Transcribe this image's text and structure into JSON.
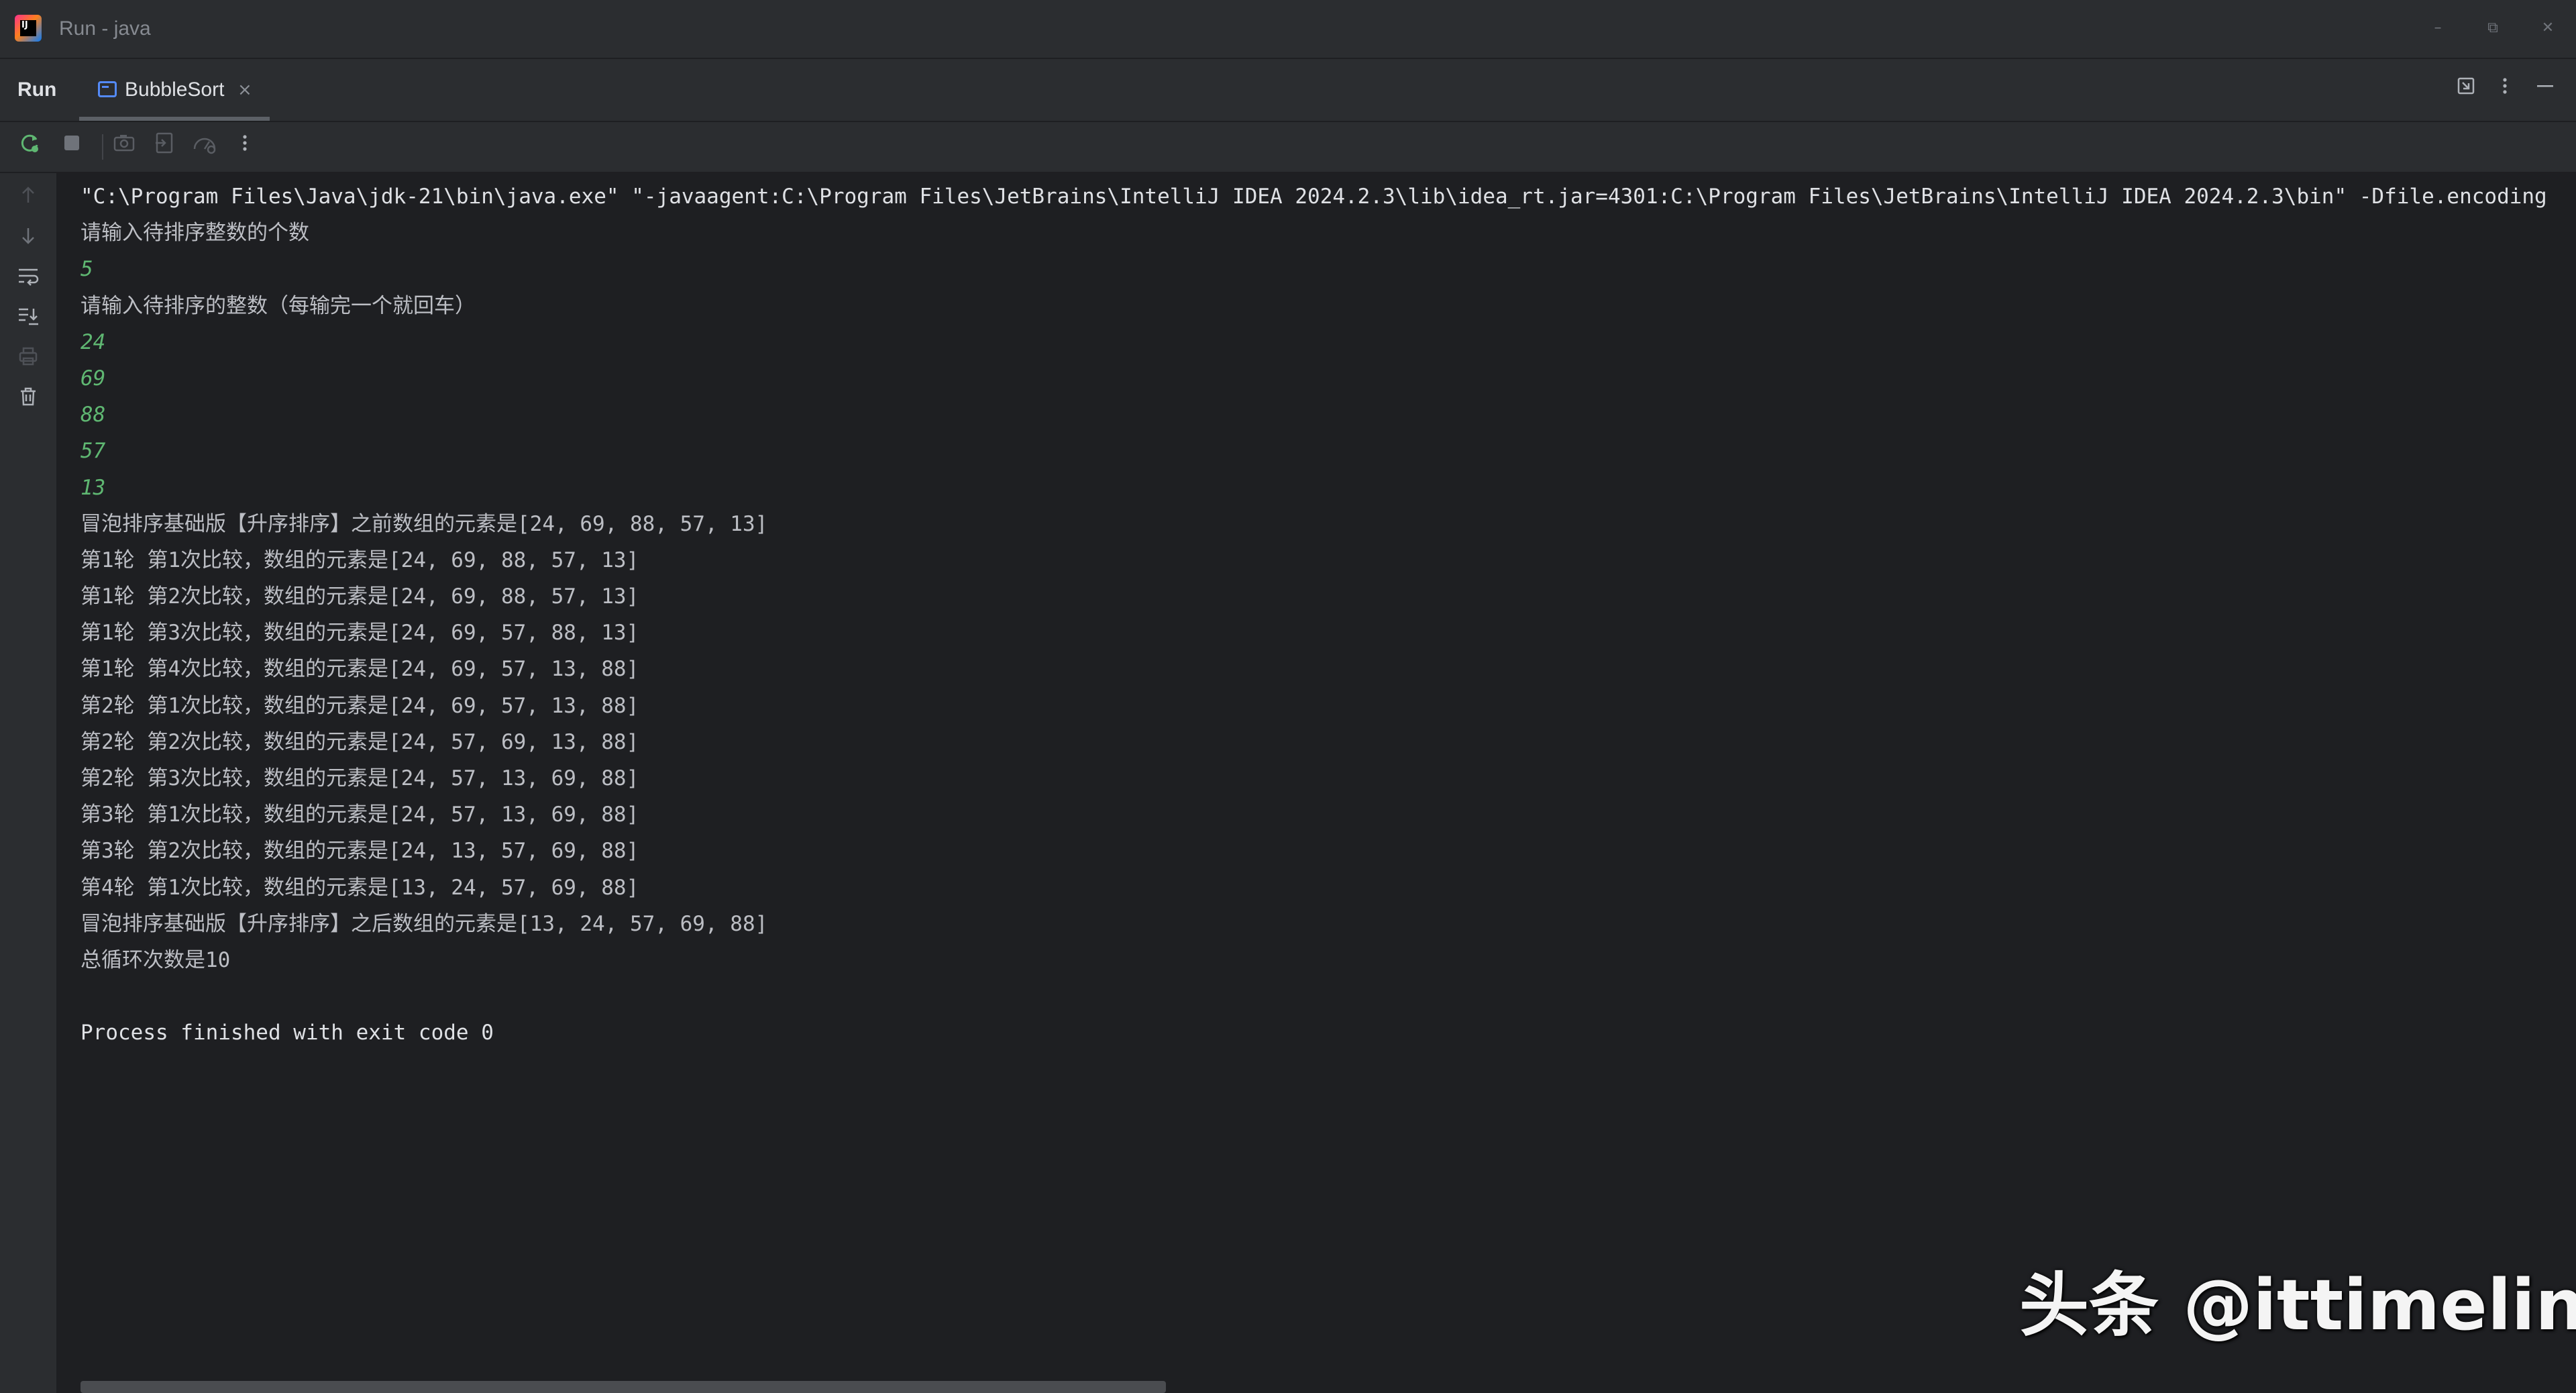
{
  "window": {
    "title": "Run - java",
    "controls": [
      "–",
      "⧉",
      "✕"
    ]
  },
  "tool_window": {
    "label": "Run",
    "tabs": [
      {
        "label": "BubbleSort",
        "close": "×",
        "icon": "run-config-icon"
      }
    ],
    "header_icons": [
      "restore-layout-icon",
      "more-options-icon",
      "minimize-icon"
    ]
  },
  "toolbar": {
    "buttons": [
      "rerun-icon",
      "stop-icon",
      "screenshot-icon",
      "export-icon",
      "profiler-icon",
      "more-icon"
    ]
  },
  "gutter": {
    "buttons": [
      "scroll-up-icon",
      "scroll-down-icon",
      "soft-wrap-icon",
      "scroll-to-end-icon",
      "print-icon",
      "clear-all-icon"
    ]
  },
  "console": {
    "lines": [
      {
        "text": "\"C:\\Program Files\\Java\\jdk-21\\bin\\java.exe\" \"-javaagent:C:\\Program Files\\JetBrains\\IntelliJ IDEA 2024.2.3\\lib\\idea_rt.jar=4301:C:\\Program Files\\JetBrains\\IntelliJ IDEA 2024.2.3\\bin\" -Dfile.encoding",
        "kind": "cmd"
      },
      {
        "text": "请输入待排序整数的个数",
        "kind": "out"
      },
      {
        "text": "5",
        "kind": "input"
      },
      {
        "text": "请输入待排序的整数（每输完一个就回车）",
        "kind": "out"
      },
      {
        "text": "24",
        "kind": "input"
      },
      {
        "text": "69",
        "kind": "input"
      },
      {
        "text": "88",
        "kind": "input"
      },
      {
        "text": "57",
        "kind": "input"
      },
      {
        "text": "13",
        "kind": "input"
      },
      {
        "text": "冒泡排序基础版【升序排序】之前数组的元素是[24, 69, 88, 57, 13]",
        "kind": "out"
      },
      {
        "text": "第1轮 第1次比较，数组的元素是[24, 69, 88, 57, 13]",
        "kind": "out"
      },
      {
        "text": "第1轮 第2次比较，数组的元素是[24, 69, 88, 57, 13]",
        "kind": "out"
      },
      {
        "text": "第1轮 第3次比较，数组的元素是[24, 69, 57, 88, 13]",
        "kind": "out"
      },
      {
        "text": "第1轮 第4次比较，数组的元素是[24, 69, 57, 13, 88]",
        "kind": "out"
      },
      {
        "text": "第2轮 第1次比较，数组的元素是[24, 69, 57, 13, 88]",
        "kind": "out"
      },
      {
        "text": "第2轮 第2次比较，数组的元素是[24, 57, 69, 13, 88]",
        "kind": "out"
      },
      {
        "text": "第2轮 第3次比较，数组的元素是[24, 57, 13, 69, 88]",
        "kind": "out"
      },
      {
        "text": "第3轮 第1次比较，数组的元素是[24, 57, 13, 69, 88]",
        "kind": "out"
      },
      {
        "text": "第3轮 第2次比较，数组的元素是[24, 13, 57, 69, 88]",
        "kind": "out"
      },
      {
        "text": "第4轮 第1次比较，数组的元素是[13, 24, 57, 69, 88]",
        "kind": "out"
      },
      {
        "text": "冒泡排序基础版【升序排序】之后数组的元素是[13, 24, 57, 69, 88]",
        "kind": "out"
      },
      {
        "text": "总循环次数是10",
        "kind": "out"
      },
      {
        "text": "",
        "kind": "out"
      },
      {
        "text": "Process finished with exit code 0",
        "kind": "cmd"
      }
    ]
  },
  "watermark": {
    "text": "头条 @ittimeline"
  }
}
